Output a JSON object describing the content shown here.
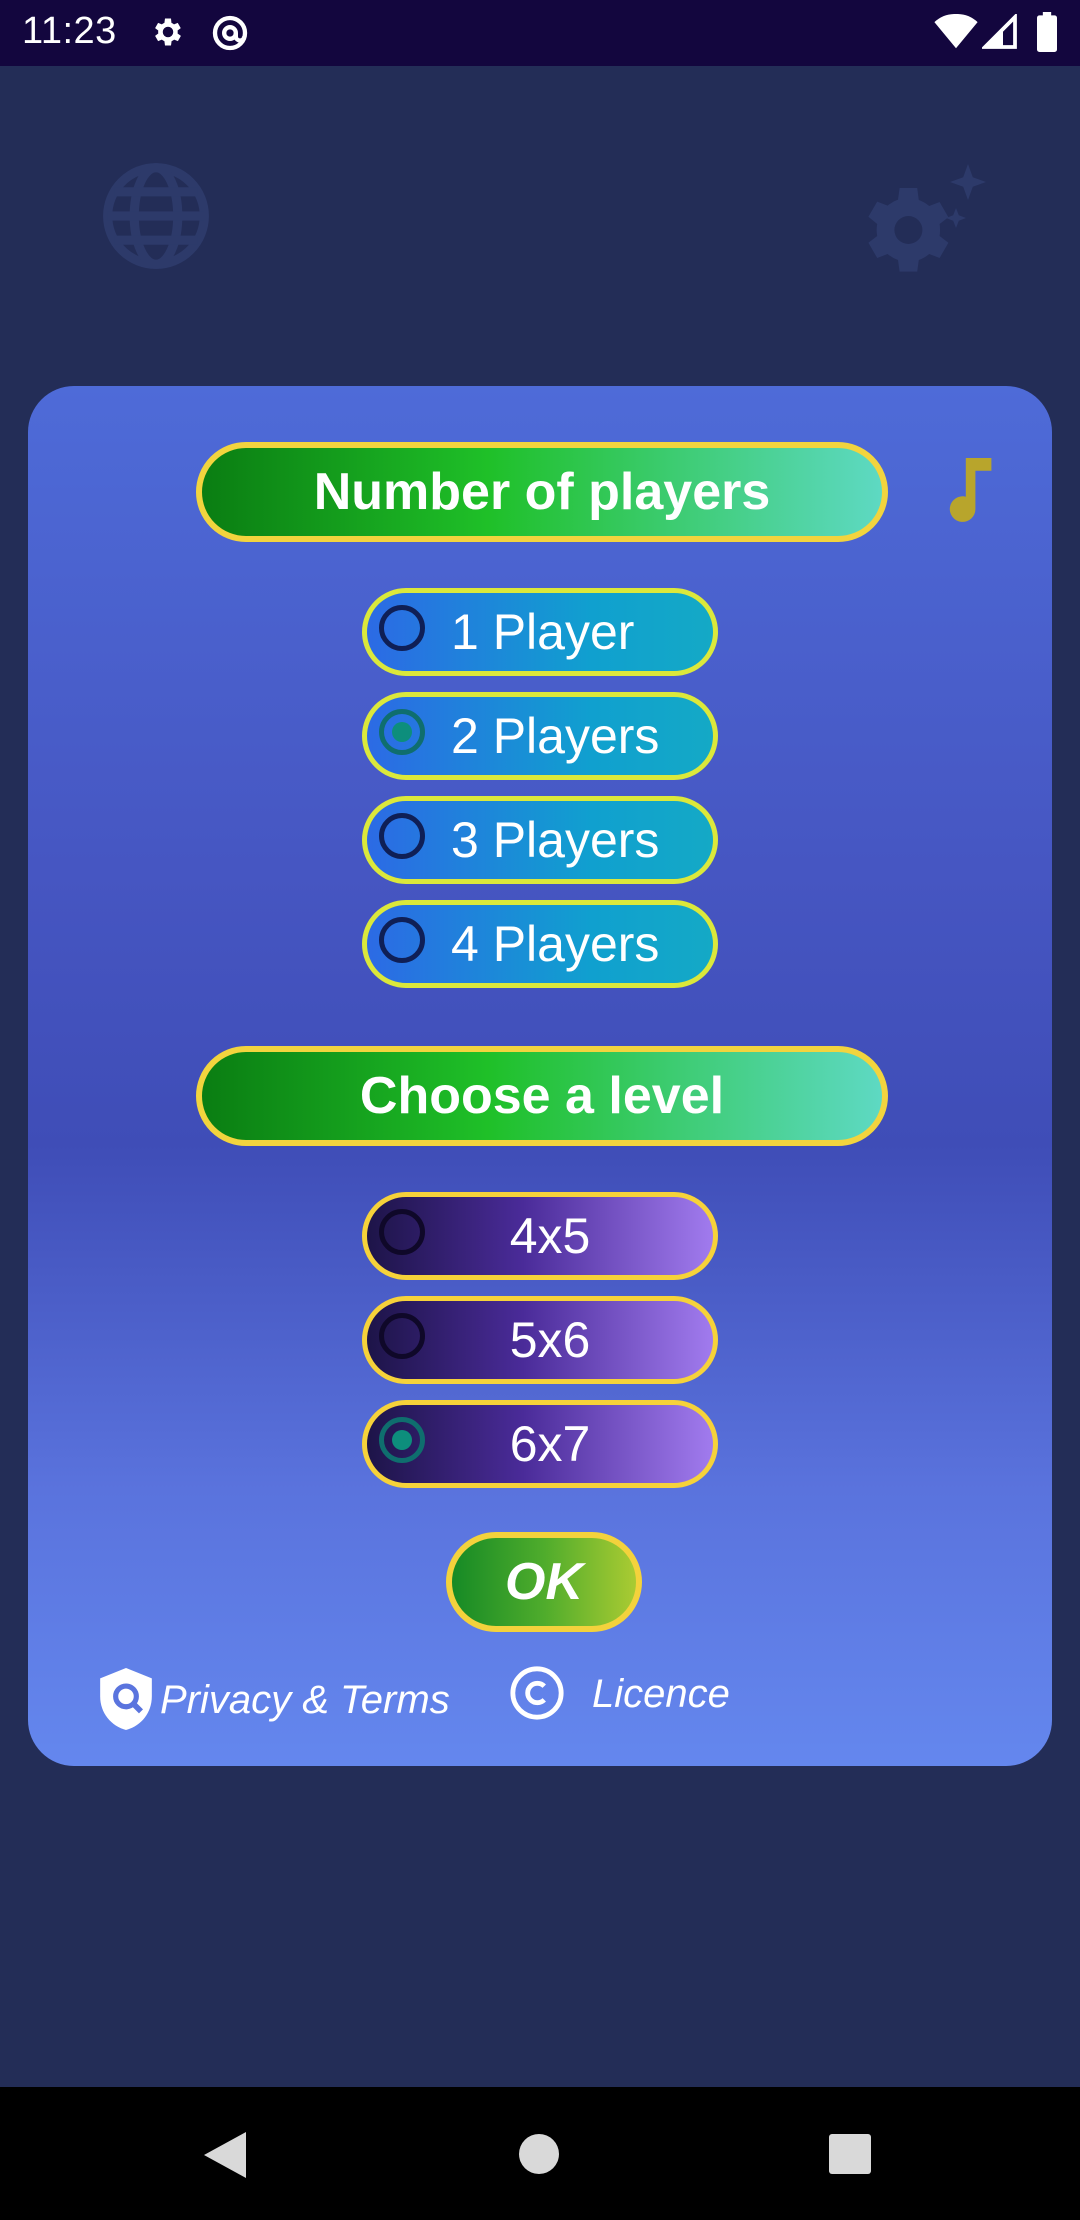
{
  "status_bar": {
    "time": "11:23",
    "icons": [
      "settings-icon",
      "at-sign-icon",
      "wifi-icon",
      "signal-icon",
      "battery-icon"
    ]
  },
  "background": {
    "icons": [
      "globe-icon",
      "gear-sparkle-icon"
    ]
  },
  "dialog": {
    "players_header": "Number of players",
    "music_icon": "music-note-icon",
    "player_options": [
      {
        "label": "1 Player",
        "selected": false
      },
      {
        "label": "2 Players",
        "selected": true
      },
      {
        "label": "3 Players",
        "selected": false
      },
      {
        "label": "4 Players",
        "selected": false
      }
    ],
    "level_header": "Choose a level",
    "level_options": [
      {
        "label": "4x5",
        "selected": false
      },
      {
        "label": "5x6",
        "selected": false
      },
      {
        "label": "6x7",
        "selected": true
      }
    ],
    "ok_label": "OK",
    "privacy_label": "Privacy & Terms",
    "licence_label": "Licence"
  },
  "nav_bar": {
    "icons": [
      "back-icon",
      "home-icon",
      "recents-icon"
    ]
  },
  "colors": {
    "page_bg": "#232d57",
    "status_bar_bg": "#13063e",
    "dialog_top": "#4e6bd8",
    "dialog_bottom": "#6487ee",
    "header_green": "#1fc028",
    "pill_border_yellow": "#f2d43e",
    "music_note": "#b8a52c"
  }
}
